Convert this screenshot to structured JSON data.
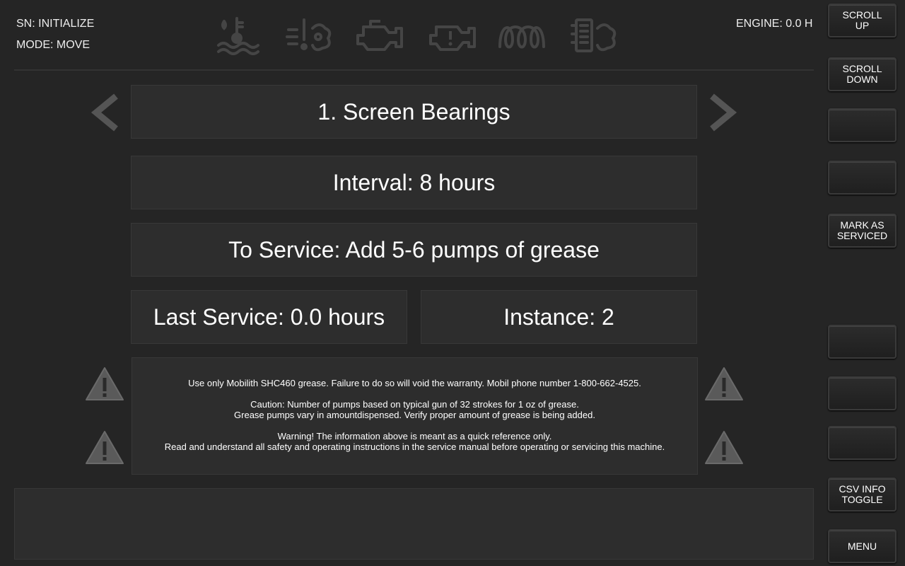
{
  "status": {
    "serial": "SN: INITIALIZE",
    "mode": "MODE: MOVE",
    "engine": "ENGINE: 0.0 H"
  },
  "indicator_icons": [
    "coolant-temp-icon",
    "warning-exhaust-icon",
    "check-engine-icon",
    "engine-warning-icon",
    "glow-plug-icon",
    "dpf-regeneration-icon"
  ],
  "task": {
    "title": "1. Screen Bearings",
    "interval": "Interval: 8 hours",
    "to_service": "To Service: Add 5-6 pumps of grease",
    "last_service": "Last Service: 0.0 hours",
    "instance": "Instance: 2"
  },
  "notice": {
    "line1": "Use only Mobilith SHC460 grease. Failure to do so will void the warranty. Mobil phone number 1-800-662-4525.",
    "line2": "Caution: Number of pumps based on typical gun of 32 strokes for 1 oz of grease.",
    "line3": "Grease pumps vary in amountdispensed. Verify proper amount of grease is being added.",
    "line4": "Warning! The information above is meant as a quick reference only.",
    "line5": "Read and understand all safety and operating instructions in the service manual before operating or servicing this machine."
  },
  "side_buttons": {
    "scroll_up": "SCROLL\nUP",
    "scroll_down": "SCROLL\nDOWN",
    "blank_1": "",
    "blank_2": "",
    "mark_serviced": "MARK AS\nSERVICED",
    "blank_3": "",
    "blank_4": "",
    "blank_5": "",
    "csv_toggle": "CSV INFO\nTOGGLE",
    "menu": "MENU"
  },
  "colors": {
    "background": "#252525",
    "panel": "#2d2d2d",
    "text": "#ffffff",
    "warning_triangle": "#5a5a5a"
  }
}
